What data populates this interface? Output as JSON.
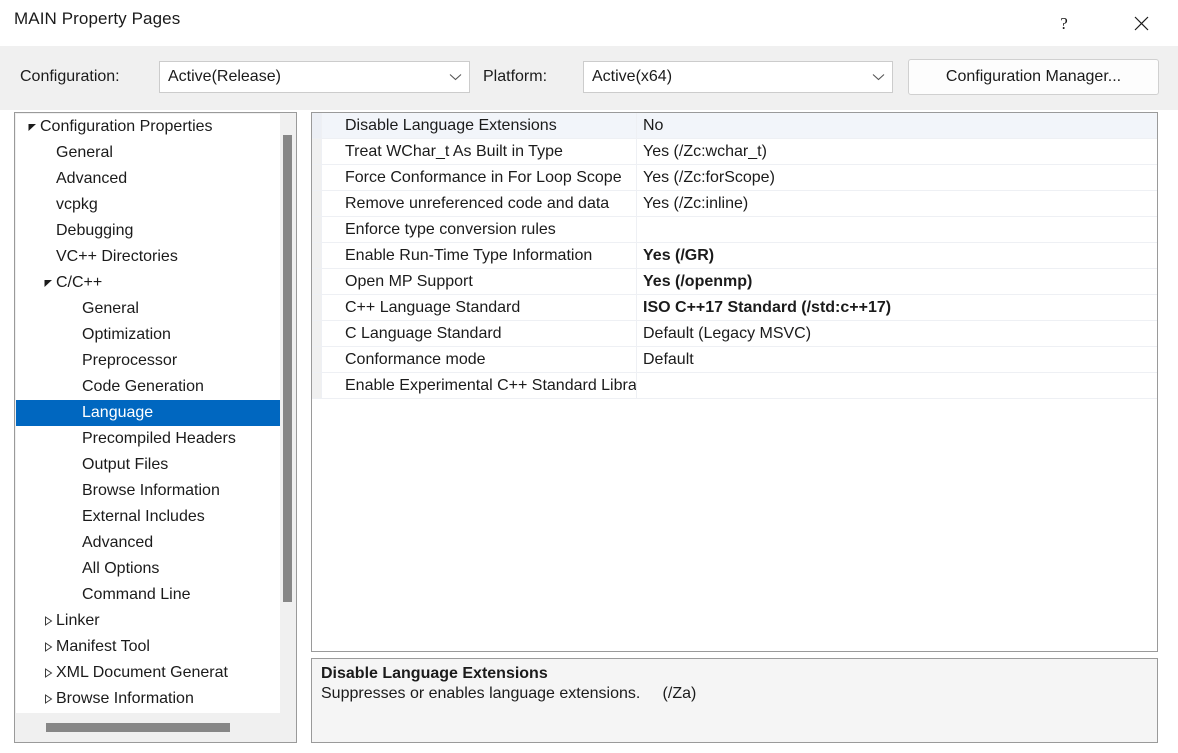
{
  "window": {
    "title": "MAIN Property Pages",
    "help_button": "?",
    "close_button": "✕"
  },
  "toolbar": {
    "configuration_label": "Configuration:",
    "configuration_value": "Active(Release)",
    "platform_label": "Platform:",
    "platform_value": "Active(x64)",
    "configuration_manager_label": "Configuration Manager..."
  },
  "tree": {
    "selected": "Language",
    "items": [
      {
        "label": "Configuration Properties",
        "level": 0,
        "state": "expanded"
      },
      {
        "label": "General",
        "level": 1,
        "state": "leaf"
      },
      {
        "label": "Advanced",
        "level": 1,
        "state": "leaf"
      },
      {
        "label": "vcpkg",
        "level": 1,
        "state": "leaf"
      },
      {
        "label": "Debugging",
        "level": 1,
        "state": "leaf"
      },
      {
        "label": "VC++ Directories",
        "level": 1,
        "state": "leaf"
      },
      {
        "label": "C/C++",
        "level": 1,
        "state": "expanded"
      },
      {
        "label": "General",
        "level": 2,
        "state": "leaf"
      },
      {
        "label": "Optimization",
        "level": 2,
        "state": "leaf"
      },
      {
        "label": "Preprocessor",
        "level": 2,
        "state": "leaf"
      },
      {
        "label": "Code Generation",
        "level": 2,
        "state": "leaf"
      },
      {
        "label": "Language",
        "level": 2,
        "state": "leaf",
        "selected": true
      },
      {
        "label": "Precompiled Headers",
        "level": 2,
        "state": "leaf"
      },
      {
        "label": "Output Files",
        "level": 2,
        "state": "leaf"
      },
      {
        "label": "Browse Information",
        "level": 2,
        "state": "leaf"
      },
      {
        "label": "External Includes",
        "level": 2,
        "state": "leaf"
      },
      {
        "label": "Advanced",
        "level": 2,
        "state": "leaf"
      },
      {
        "label": "All Options",
        "level": 2,
        "state": "leaf"
      },
      {
        "label": "Command Line",
        "level": 2,
        "state": "leaf"
      },
      {
        "label": "Linker",
        "level": 1,
        "state": "collapsed"
      },
      {
        "label": "Manifest Tool",
        "level": 1,
        "state": "collapsed"
      },
      {
        "label": "XML Document Generat",
        "level": 1,
        "state": "collapsed"
      },
      {
        "label": "Browse Information",
        "level": 1,
        "state": "collapsed"
      }
    ]
  },
  "grid": {
    "rows": [
      {
        "name": "Disable Language Extensions",
        "value": "No",
        "modified": false,
        "selected": true
      },
      {
        "name": "Treat WChar_t As Built in Type",
        "value": "Yes (/Zc:wchar_t)",
        "modified": false
      },
      {
        "name": "Force Conformance in For Loop Scope",
        "value": "Yes (/Zc:forScope)",
        "modified": false
      },
      {
        "name": "Remove unreferenced code and data",
        "value": "Yes (/Zc:inline)",
        "modified": false
      },
      {
        "name": "Enforce type conversion rules",
        "value": "",
        "modified": false
      },
      {
        "name": "Enable Run-Time Type Information",
        "value": "Yes (/GR)",
        "modified": true
      },
      {
        "name": "Open MP Support",
        "value": "Yes (/openmp)",
        "modified": true
      },
      {
        "name": "C++ Language Standard",
        "value": "ISO C++17 Standard (/std:c++17)",
        "modified": true
      },
      {
        "name": "C Language Standard",
        "value": "Default (Legacy MSVC)",
        "modified": false
      },
      {
        "name": "Conformance mode",
        "value": "Default",
        "modified": false
      },
      {
        "name": "Enable Experimental C++ Standard Library Modules",
        "value": "",
        "modified": false
      }
    ]
  },
  "description": {
    "title": "Disable Language Extensions",
    "text": "Suppresses or enables language extensions.     (/Za)"
  },
  "colors": {
    "selection_blue": "#0067c0",
    "strip_background": "#f0f0f0",
    "panel_border": "#9a9a9a",
    "scrollbar_thumb": "#878787",
    "row_separator": "#eef0f4"
  }
}
